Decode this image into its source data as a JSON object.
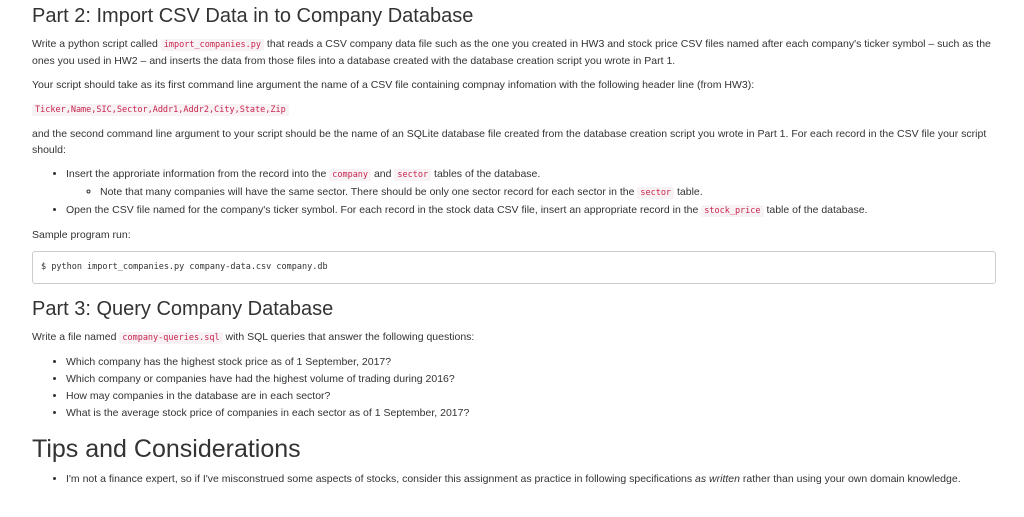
{
  "part2": {
    "heading": "Part 2: Import CSV Data in to Company Database",
    "para1": {
      "t1": "Write a python script called ",
      "code1": "import_companies.py",
      "t2": " that reads a CSV company data file such as the one you created in HW3 and stock price CSV files named after each company's ticker symbol – such as the ones you used in HW2 – and inserts the data from those files into a database created with the database creation script you wrote in Part 1."
    },
    "para2": "Your script should take as its first command line argument the name of a CSV file containing compnay infomation with the following header line (from HW3):",
    "header_line": "Ticker,Name,SIC,Sector,Addr1,Addr2,City,State,Zip",
    "para3": "and the second command line argument to your script should be the name of an SQLite database file created from the database creation script you wrote in Part 1. For each record in the CSV file your script should:",
    "bullet1": {
      "t1": "Insert the approriate information from the record into the ",
      "code1": "company",
      "t2": " and ",
      "code2": "sector",
      "t3": " tables of the database."
    },
    "subbullet1": {
      "t1": "Note that many companies will have the same sector. There should be only one sector record for each sector in the ",
      "code1": "sector",
      "t2": " table."
    },
    "bullet2": {
      "t1": "Open the CSV file named for the company's ticker symbol. For each record in the stock data CSV file, insert an appropriate record in the ",
      "code1": "stock_price",
      "t2": " table of the database."
    },
    "sample_label": "Sample program run:",
    "sample_command": "$ python import_companies.py company-data.csv company.db"
  },
  "part3": {
    "heading": "Part 3: Query Company Database",
    "para1": {
      "t1": "Write a file named ",
      "code1": "company-queries.sql",
      "t2": " with SQL queries that answer the following questions:"
    },
    "questions": [
      "Which company has the highest stock price as of 1 September, 2017?",
      "Which company or companies have had the highest volume of trading during 2016?",
      "How may companies in the database are in each sector?",
      "What is the average stock price of companies in each sector as of 1 September, 2017?"
    ]
  },
  "tips": {
    "heading": "Tips and Considerations",
    "bullet1": {
      "t1": "I'm not a finance expert, so if I've misconstrued some aspects of stocks, consider this assignment as practice in following specifications ",
      "em1": "as written",
      "t2": " rather than using your own domain knowledge."
    }
  }
}
